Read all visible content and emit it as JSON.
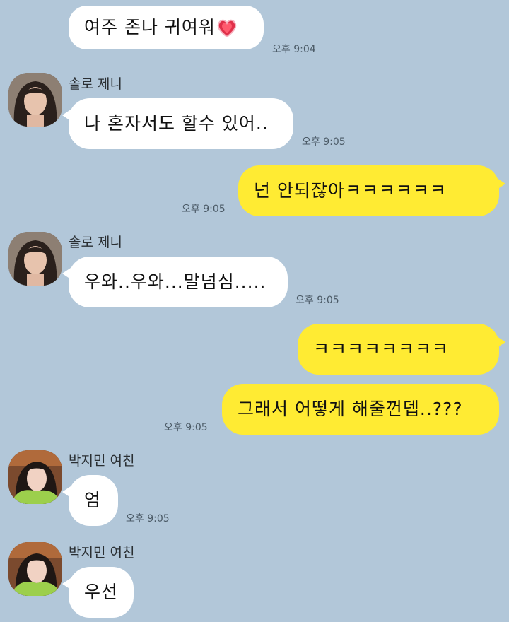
{
  "messages": [
    {
      "text": "여주 존나 귀여워",
      "time": "오후 9:04"
    },
    {
      "sender": "솔로 제니",
      "text": "나 혼자서도 할수 있어..",
      "time": "오후 9:05"
    },
    {
      "text": "넌 안되잖아ㅋㅋㅋㅋㅋㅋ",
      "time": "오후 9:05"
    },
    {
      "sender": "솔로 제니",
      "text": "우와..우와...말넘심.....",
      "time": "오후 9:05"
    },
    {
      "text": "ㅋㅋㅋㅋㅋㅋㅋㅋ"
    },
    {
      "text": "그래서 어떻게 해줄껀뎁..???",
      "time": "오후 9:05"
    },
    {
      "sender": "박지민 여친",
      "text": "엄",
      "time": "오후 9:05"
    },
    {
      "sender": "박지민 여친",
      "text": "우선"
    }
  ],
  "icons": {
    "emoji": "heart-emoji-icon",
    "avatar_jennie": "avatar-jennie",
    "avatar_girlfriend": "avatar-girlfriend"
  },
  "colors": {
    "background": "#b2c7d9",
    "my_bubble": "#ffeb33",
    "their_bubble": "#ffffff"
  }
}
